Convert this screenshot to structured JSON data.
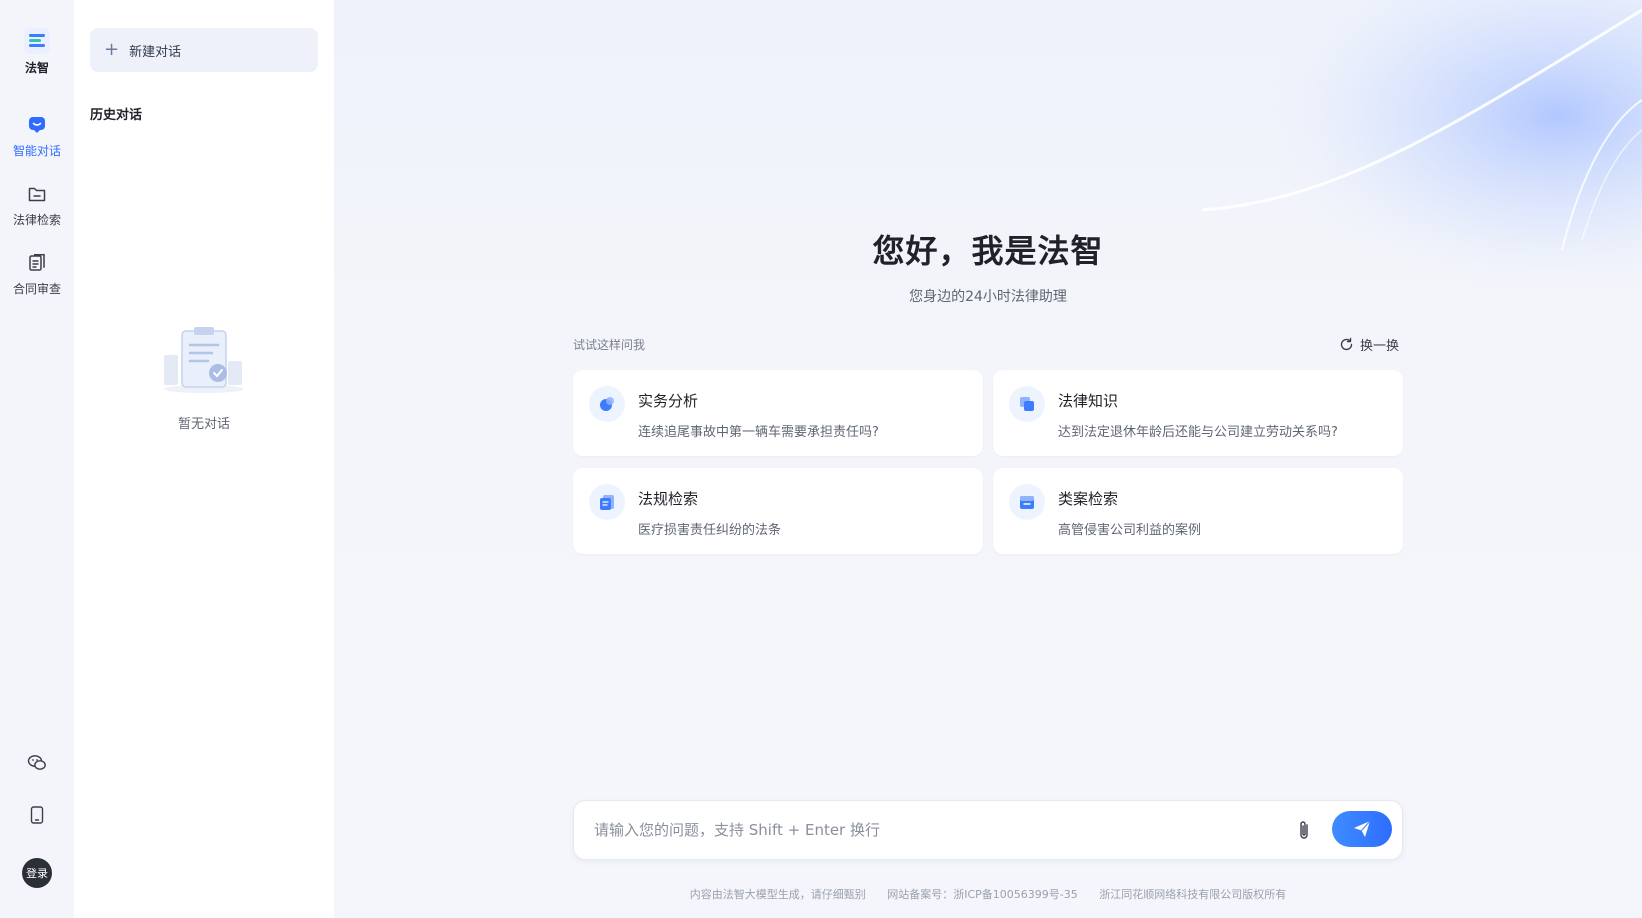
{
  "rail": {
    "brand": "法智",
    "items": [
      {
        "label": "智能对话",
        "icon": "chat-bot-icon"
      },
      {
        "label": "法律检索",
        "icon": "folder-icon"
      },
      {
        "label": "合同审查",
        "icon": "contract-icon"
      }
    ],
    "bottom": {
      "login": "登录"
    }
  },
  "history": {
    "new_chat": "新建对话",
    "title": "历史对话",
    "empty": "暂无对话"
  },
  "main": {
    "title": "您好，我是法智",
    "subtitle": "您身边的24小时法律助理",
    "try_label": "试试这样问我",
    "refresh": "换一换",
    "cards": [
      {
        "title": "实务分析",
        "desc": "连续追尾事故中第一辆车需要承担责任吗?"
      },
      {
        "title": "法律知识",
        "desc": "达到法定退休年龄后还能与公司建立劳动关系吗?"
      },
      {
        "title": "法规检索",
        "desc": "医疗损害责任纠纷的法条"
      },
      {
        "title": "类案检索",
        "desc": "高管侵害公司利益的案例"
      }
    ],
    "input_placeholder": "请输入您的问题，支持 Shift + Enter 换行",
    "footer": [
      "内容由法智大模型生成，请仔细甄别",
      "网站备案号：浙ICP备10056399号-35",
      "浙江同花顺网络科技有限公司版权所有"
    ]
  },
  "colors": {
    "accent": "#2f6bff",
    "send": "#3e8dff",
    "rail_bg": "#f3f5fa"
  }
}
